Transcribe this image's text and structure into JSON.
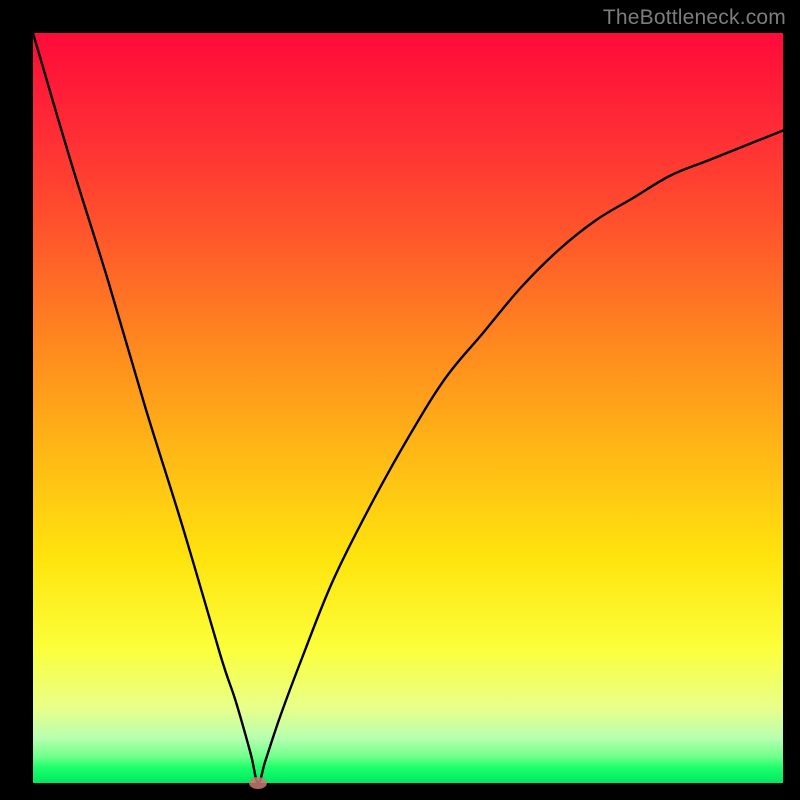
{
  "watermark": "TheBottleneck.com",
  "colors": {
    "frame": "#000000",
    "gradient_top": "#ff0a3a",
    "gradient_bottom": "#00e860",
    "curve": "#000000",
    "marker": "#c97a74"
  },
  "chart_data": {
    "type": "line",
    "title": "",
    "xlabel": "",
    "ylabel": "",
    "xlim": [
      0,
      100
    ],
    "ylim": [
      0,
      100
    ],
    "series": [
      {
        "name": "bottleneck-curve",
        "x": [
          0,
          5,
          10,
          15,
          20,
          25,
          27,
          29,
          30,
          31,
          33,
          36,
          40,
          45,
          50,
          55,
          60,
          65,
          70,
          75,
          80,
          85,
          90,
          95,
          100
        ],
        "y": [
          100,
          83,
          67,
          50,
          34,
          17,
          11,
          4,
          0,
          3,
          9,
          17,
          27,
          37,
          46,
          54,
          60,
          66,
          71,
          75,
          78,
          81,
          83,
          85,
          87
        ]
      }
    ],
    "marker": {
      "x": 30,
      "y": 0
    },
    "annotations": []
  }
}
